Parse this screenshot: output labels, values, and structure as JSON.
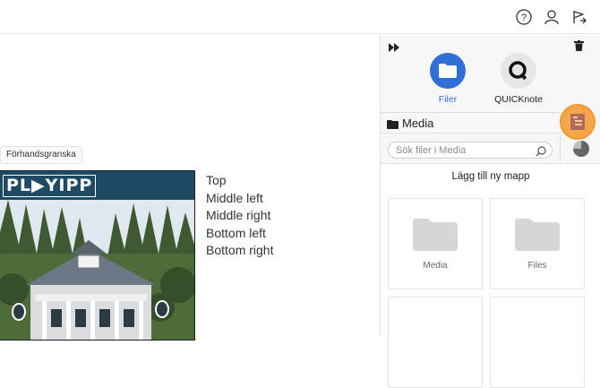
{
  "header": {
    "help_icon": "question-circle-icon",
    "user_icon": "user-icon",
    "sign_icon": "flag-arrow-icon"
  },
  "preview": {
    "label": "Förhandsgranska",
    "logo_text": "PL▶YIPP"
  },
  "positions": [
    "Top",
    "Middle left",
    "Middle right",
    "Bottom left",
    "Bottom right"
  ],
  "panel": {
    "apps": [
      {
        "label": "Filer",
        "icon": "folder-icon",
        "active": true,
        "color": "#2f6fd6"
      },
      {
        "label": "QUICKnote",
        "icon": "quicknote-icon",
        "active": false,
        "color": "#e6e6e6"
      }
    ],
    "media_title": "Media",
    "search_placeholder": "Sök filer i Media",
    "add_folder": "Lägg till ny mapp",
    "folders": [
      "Media",
      "Files",
      "",
      ""
    ]
  },
  "colors": {
    "accent_blue": "#2f6fd6",
    "highlight_orange": "#f5a54a",
    "folder_grey": "#d6d6d6"
  }
}
